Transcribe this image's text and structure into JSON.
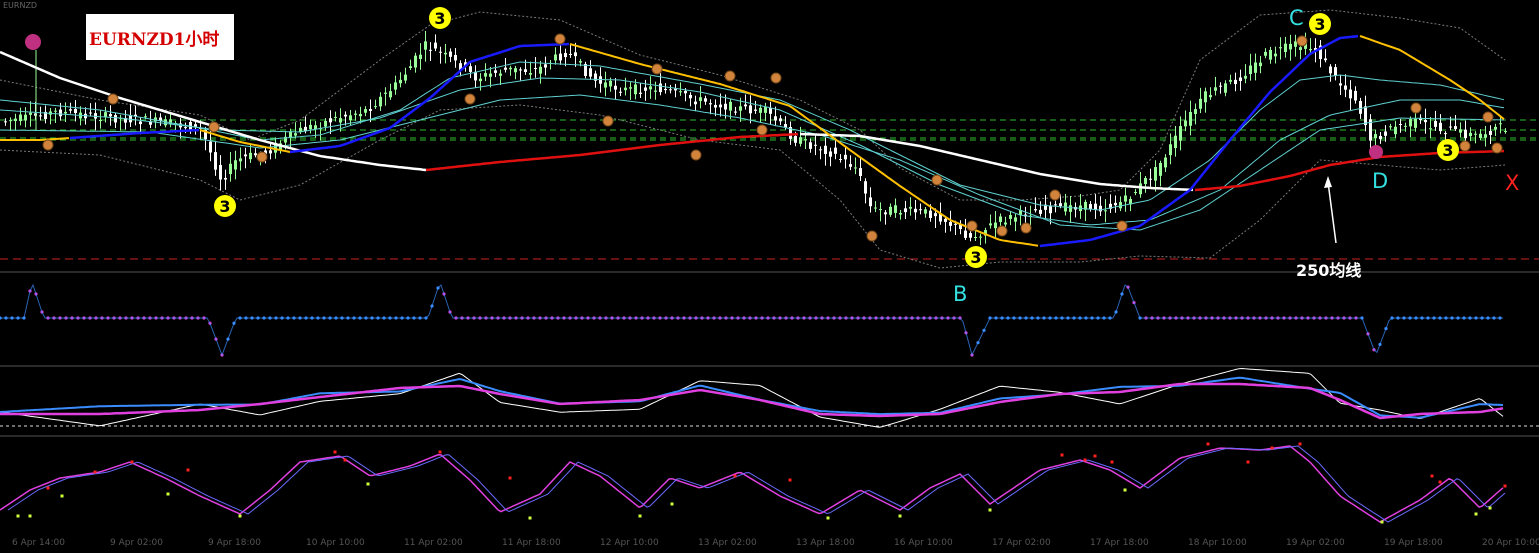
{
  "chart_data": {
    "type": "line",
    "title": "EURNZD1小时",
    "symbol_label": "EURNZD",
    "annotations": {
      "wave_labels": [
        "B",
        "C",
        "D",
        "X"
      ],
      "ma_note": "250均线",
      "count_marker": "3"
    },
    "x_ticks": [
      "6 Apr 14:00",
      "9 Apr 02:00",
      "9 Apr 18:00",
      "10 Apr 10:00",
      "11 Apr 02:00",
      "11 Apr 18:00",
      "12 Apr 10:00",
      "13 Apr 02:00",
      "13 Apr 18:00",
      "16 Apr 10:00",
      "17 Apr 02:00",
      "17 Apr 18:00",
      "18 Apr 10:00",
      "19 Apr 02:00",
      "19 Apr 18:00",
      "20 Apr 10:00"
    ],
    "panels": [
      "price",
      "osc1",
      "osc2",
      "osc3"
    ],
    "main_ma_level": 250,
    "colors": {
      "background": "#000000",
      "bull_candle": "#9aff9a",
      "bear_candle": "#ffffff",
      "ma_white": "#ffffff",
      "ma_red": "#e01010",
      "ma_blue": "#1a1aff",
      "ma_yellow": "#ffc000",
      "ma_cyan": "#5fd0d0",
      "band_grey": "#7a7a7a",
      "green_level": "#33cc33",
      "red_level": "#cc2222",
      "osc_blue": "#3a8cff",
      "osc_magenta": "#e040e0",
      "marker_orange": "#d2843c",
      "marker_yellow": "#ffff00",
      "marker_pink": "#c03080",
      "label_cyan": "#33e0e0",
      "label_red": "#ff2020",
      "dot_red": "#ff2020",
      "dot_yellow": "#d0ff40"
    }
  }
}
